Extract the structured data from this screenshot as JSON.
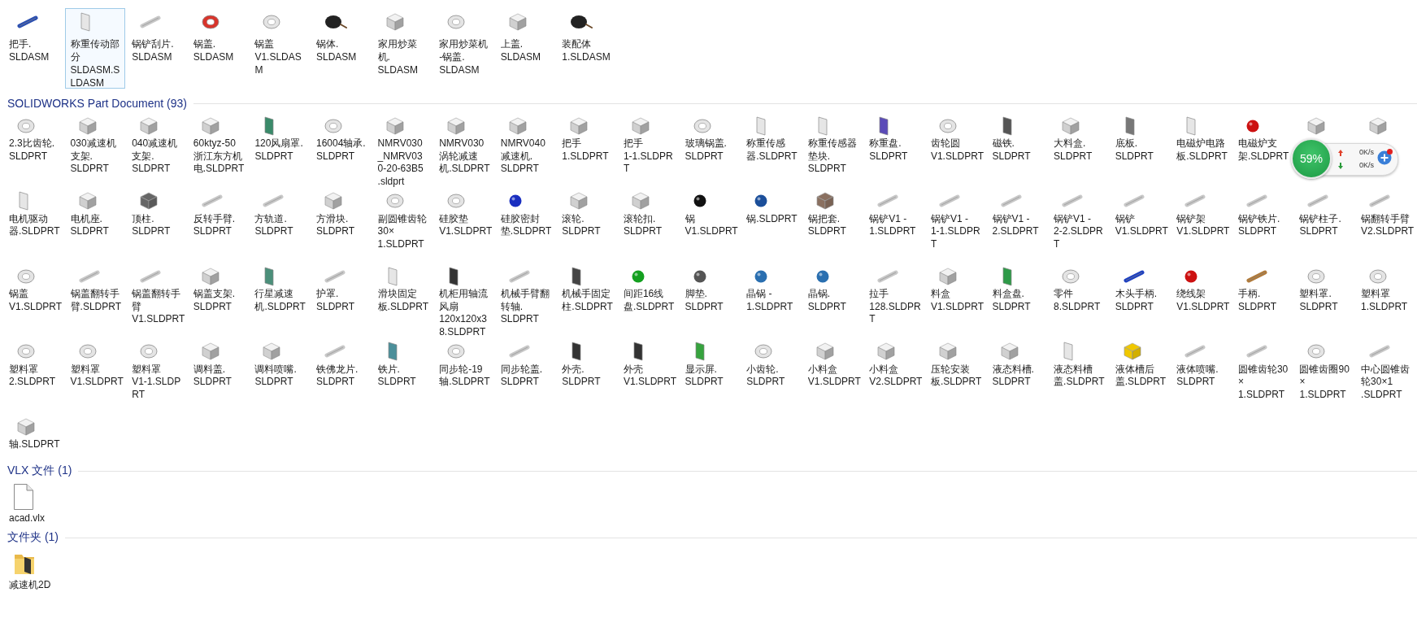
{
  "groups": [
    {
      "items": [
        {
          "label_lines": [
            "把手.",
            "SLDASM"
          ],
          "kind": "rod",
          "color": "#2b4fb0",
          "selected": false
        },
        {
          "label_lines": [
            "称重传动部",
            "分",
            "SLDASM.S",
            "LDASM"
          ],
          "kind": "panel",
          "selected": true
        },
        {
          "label_lines": [
            "锅铲刮片.",
            "SLDASM"
          ],
          "kind": "rod",
          "selected": false
        },
        {
          "label_lines": [
            "锅盖.",
            "SLDASM"
          ],
          "kind": "disc",
          "color": "#d9342b",
          "selected": false
        },
        {
          "label_lines": [
            "锅盖",
            "V1.SLDAS",
            "M"
          ],
          "kind": "disc",
          "selected": false
        },
        {
          "label_lines": [
            "锅体.",
            "SLDASM"
          ],
          "kind": "wok",
          "selected": false
        },
        {
          "label_lines": [
            "家用炒菜",
            "机.",
            "SLDASM"
          ],
          "kind": "block",
          "selected": false
        },
        {
          "label_lines": [
            "家用炒菜机",
            "-锅盖.",
            "SLDASM"
          ],
          "kind": "disc",
          "selected": false
        },
        {
          "label_lines": [
            "上盖.",
            "SLDASM"
          ],
          "kind": "block",
          "selected": false
        },
        {
          "label_lines": [
            "装配体",
            "1.SLDASM"
          ],
          "kind": "wok",
          "selected": false
        }
      ]
    },
    {
      "title": "SOLIDWORKS Part Document (93)",
      "items": [
        {
          "label_lines": [
            "2.3比齿轮.",
            "SLDPRT"
          ],
          "kind": "disc",
          "selected": false
        },
        {
          "label_lines": [
            "030减速机",
            "支架.",
            "SLDPRT"
          ],
          "kind": "block",
          "selected": false
        },
        {
          "label_lines": [
            "040减速机",
            "支架.",
            "SLDPRT"
          ],
          "kind": "block",
          "selected": false
        },
        {
          "label_lines": [
            "60ktyz-50",
            "浙江东方机",
            "电.SLDPRT"
          ],
          "kind": "block",
          "selected": false
        },
        {
          "label_lines": [
            "120风扇罩.",
            "SLDPRT"
          ],
          "kind": "panel",
          "color": "#3a8a6a",
          "selected": false
        },
        {
          "label_lines": [
            "16004轴承.",
            "SLDPRT"
          ],
          "kind": "disc",
          "selected": false
        },
        {
          "label_lines": [
            "NMRV030",
            "_NMRV03",
            "0-20-63B5",
            ".sldprt"
          ],
          "kind": "block",
          "selected": false
        },
        {
          "label_lines": [
            "NMRV030",
            "涡轮减速",
            "机.SLDPRT"
          ],
          "kind": "block",
          "selected": false
        },
        {
          "label_lines": [
            "NMRV040",
            "减速机.",
            "SLDPRT"
          ],
          "kind": "block",
          "selected": false
        },
        {
          "label_lines": [
            "把手",
            "1.SLDPRT"
          ],
          "kind": "block",
          "selected": false
        },
        {
          "label_lines": [
            "把手",
            "1-1.SLDPR",
            "T"
          ],
          "kind": "block",
          "selected": false
        },
        {
          "label_lines": [
            "玻璃锅盖.",
            "SLDPRT"
          ],
          "kind": "disc",
          "selected": false
        },
        {
          "label_lines": [
            "称重传感",
            "器.SLDPRT"
          ],
          "kind": "panel",
          "selected": false
        },
        {
          "label_lines": [
            "称重传感器",
            "垫块.",
            "SLDPRT"
          ],
          "kind": "panel",
          "selected": false
        },
        {
          "label_lines": [
            "称重盘.",
            "SLDPRT"
          ],
          "kind": "panel",
          "color": "#5b4bb8",
          "selected": false
        },
        {
          "label_lines": [
            "齿轮圆",
            "V1.SLDPRT"
          ],
          "kind": "disc",
          "selected": false
        },
        {
          "label_lines": [
            "磁铁.",
            "SLDPRT"
          ],
          "kind": "panel",
          "color": "#555555",
          "selected": false
        },
        {
          "label_lines": [
            "大料盒.",
            "SLDPRT"
          ],
          "kind": "block",
          "selected": false
        },
        {
          "label_lines": [
            "底板.",
            "SLDPRT"
          ],
          "kind": "panel",
          "color": "#777777",
          "selected": false
        },
        {
          "label_lines": [
            "电磁炉电路",
            "板.SLDPRT"
          ],
          "kind": "panel",
          "selected": false
        },
        {
          "label_lines": [
            "电磁炉支",
            "架.SLDPRT"
          ],
          "kind": "knob",
          "color": "#cc1111",
          "selected": false
        },
        {
          "kind": "block",
          "selected": false
        },
        {
          "kind": "block",
          "selected": false
        },
        {
          "label_lines": [
            "电机驱动",
            "器.SLDPRT"
          ],
          "kind": "panel",
          "selected": false
        },
        {
          "label_lines": [
            "电机座.",
            "SLDPRT"
          ],
          "kind": "block",
          "selected": false
        },
        {
          "label_lines": [
            "顶柱.",
            "SLDPRT"
          ],
          "kind": "block",
          "color": "#666666",
          "selected": false
        },
        {
          "label_lines": [
            "反转手臂.",
            "SLDPRT"
          ],
          "kind": "rod",
          "selected": false
        },
        {
          "label_lines": [
            "方轨道.",
            "SLDPRT"
          ],
          "kind": "rod",
          "selected": false
        },
        {
          "label_lines": [
            "方滑块.",
            "SLDPRT"
          ],
          "kind": "block",
          "selected": false
        },
        {
          "label_lines": [
            "副圆锥齿轮",
            "30×",
            "1.SLDPRT"
          ],
          "kind": "disc",
          "selected": false
        },
        {
          "label_lines": [
            "硅胶垫",
            "V1.SLDPRT"
          ],
          "kind": "disc",
          "selected": false
        },
        {
          "label_lines": [
            "硅胶密封",
            "垫.SLDPRT"
          ],
          "kind": "knob",
          "color": "#1a2fc0",
          "selected": false
        },
        {
          "label_lines": [
            "滚轮.",
            "SLDPRT"
          ],
          "kind": "block",
          "selected": false
        },
        {
          "label_lines": [
            "滚轮扣.",
            "SLDPRT"
          ],
          "kind": "block",
          "selected": false
        },
        {
          "label_lines": [
            "锅",
            "V1.SLDPRT"
          ],
          "kind": "knob",
          "color": "#111111",
          "selected": false
        },
        {
          "label_lines": [
            "锅.SLDPRT"
          ],
          "kind": "knob",
          "color": "#1c4f9a",
          "selected": false
        },
        {
          "label_lines": [
            "锅把套.",
            "SLDPRT"
          ],
          "kind": "block",
          "color": "#8a7060",
          "selected": false
        },
        {
          "label_lines": [
            "锅铲V1 -",
            "1.SLDPRT"
          ],
          "kind": "rod",
          "selected": false
        },
        {
          "label_lines": [
            "锅铲V1 -",
            "1-1.SLDPR",
            "T"
          ],
          "kind": "rod",
          "selected": false
        },
        {
          "label_lines": [
            "锅铲V1 -",
            "2.SLDPRT"
          ],
          "kind": "rod",
          "selected": false
        },
        {
          "label_lines": [
            "锅铲V1 -",
            "2-2.SLDPR",
            "T"
          ],
          "kind": "rod",
          "selected": false
        },
        {
          "label_lines": [
            "锅铲",
            "V1.SLDPRT"
          ],
          "kind": "rod",
          "selected": false
        },
        {
          "label_lines": [
            "锅铲架",
            "V1.SLDPRT"
          ],
          "kind": "rod",
          "selected": false
        },
        {
          "label_lines": [
            "锅铲铁片.",
            "SLDPRT"
          ],
          "kind": "rod",
          "selected": false
        },
        {
          "label_lines": [
            "锅铲柱子.",
            "SLDPRT"
          ],
          "kind": "rod",
          "selected": false
        },
        {
          "label_lines": [
            "锅翻转手臂",
            "V2.SLDPRT"
          ],
          "kind": "rod",
          "selected": false
        },
        {
          "label_lines": [
            "锅盖",
            "V1.SLDPRT"
          ],
          "kind": "disc",
          "selected": false
        },
        {
          "label_lines": [
            "锅盖翻转手",
            "臂.SLDPRT"
          ],
          "kind": "rod",
          "selected": false
        },
        {
          "label_lines": [
            "锅盖翻转手",
            "臂",
            "V1.SLDPRT"
          ],
          "kind": "rod",
          "selected": false
        },
        {
          "label_lines": [
            "锅盖支架.",
            "SLDPRT"
          ],
          "kind": "block",
          "selected": false
        },
        {
          "label_lines": [
            "行星减速",
            "机.SLDPRT"
          ],
          "kind": "panel",
          "color": "#4b8f7a",
          "selected": false
        },
        {
          "label_lines": [
            "护罩.",
            "SLDPRT"
          ],
          "kind": "rod",
          "selected": false
        },
        {
          "label_lines": [
            "滑块固定",
            "板.SLDPRT"
          ],
          "kind": "panel",
          "selected": false
        },
        {
          "label_lines": [
            "机柜用轴流",
            "风扇",
            "120x120x3",
            "8.SLDPRT"
          ],
          "kind": "panel",
          "color": "#333333",
          "selected": false
        },
        {
          "label_lines": [
            "机械手臂翻",
            "转轴.",
            "SLDPRT"
          ],
          "kind": "rod",
          "selected": false
        },
        {
          "label_lines": [
            "机械手固定",
            "柱.SLDPRT"
          ],
          "kind": "panel",
          "color": "#444444",
          "selected": false
        },
        {
          "label_lines": [
            "间距16线",
            "盘.SLDPRT"
          ],
          "kind": "knob",
          "color": "#14a020",
          "selected": false
        },
        {
          "label_lines": [
            "脚垫.",
            "SLDPRT"
          ],
          "kind": "knob",
          "color": "#555555",
          "selected": false
        },
        {
          "label_lines": [
            "晶锅 -",
            "1.SLDPRT"
          ],
          "kind": "knob",
          "color": "#2a6fb0",
          "selected": false
        },
        {
          "label_lines": [
            "晶锅.",
            "SLDPRT"
          ],
          "kind": "knob",
          "color": "#2a6fb0",
          "selected": false
        },
        {
          "label_lines": [
            "拉手",
            "128.SLDPR",
            "T"
          ],
          "kind": "rod",
          "selected": false
        },
        {
          "label_lines": [
            "料盒",
            "V1.SLDPRT"
          ],
          "kind": "block",
          "selected": false
        },
        {
          "label_lines": [
            "料盒盘.",
            "SLDPRT"
          ],
          "kind": "panel",
          "color": "#2e9a48",
          "selected": false
        },
        {
          "label_lines": [
            "零件",
            "8.SLDPRT"
          ],
          "kind": "disc",
          "selected": false
        },
        {
          "label_lines": [
            "木头手柄.",
            "SLDPRT"
          ],
          "kind": "rod",
          "color": "#1e40c0",
          "selected": false
        },
        {
          "label_lines": [
            "绕线架",
            "V1.SLDPRT"
          ],
          "kind": "knob",
          "color": "#cc1111",
          "selected": false
        },
        {
          "label_lines": [
            "手柄.",
            "SLDPRT"
          ],
          "kind": "rod",
          "color": "#b07a3a",
          "selected": false
        },
        {
          "label_lines": [
            "塑料罩.",
            "SLDPRT"
          ],
          "kind": "disc",
          "selected": false
        },
        {
          "label_lines": [
            "塑料罩",
            "1.SLDPRT"
          ],
          "kind": "disc",
          "selected": false
        },
        {
          "label_lines": [
            "塑料罩",
            "2.SLDPRT"
          ],
          "kind": "disc",
          "selected": false
        },
        {
          "label_lines": [
            "塑料罩",
            "V1.SLDPRT"
          ],
          "kind": "disc",
          "selected": false
        },
        {
          "label_lines": [
            "塑料罩",
            "V1-1.SLDP",
            "RT"
          ],
          "kind": "disc",
          "selected": false
        },
        {
          "label_lines": [
            "调料盖.",
            "SLDPRT"
          ],
          "kind": "block",
          "selected": false
        },
        {
          "label_lines": [
            "调料喷嘴.",
            "SLDPRT"
          ],
          "kind": "block",
          "selected": false
        },
        {
          "label_lines": [
            "铁佛龙片.",
            "SLDPRT"
          ],
          "kind": "rod",
          "selected": false
        },
        {
          "label_lines": [
            "铁片.",
            "SLDPRT"
          ],
          "kind": "panel",
          "color": "#4b8f9a",
          "selected": false
        },
        {
          "label_lines": [
            "同步轮-19",
            "轴.SLDPRT"
          ],
          "kind": "disc",
          "selected": false
        },
        {
          "label_lines": [
            "同步轮盖.",
            "SLDPRT"
          ],
          "kind": "rod",
          "selected": false
        },
        {
          "label_lines": [
            "外壳.",
            "SLDPRT"
          ],
          "kind": "panel",
          "color": "#333333",
          "selected": false
        },
        {
          "label_lines": [
            "外壳",
            "V1.SLDPRT"
          ],
          "kind": "panel",
          "color": "#333333",
          "selected": false
        },
        {
          "label_lines": [
            "显示屏.",
            "SLDPRT"
          ],
          "kind": "panel",
          "color": "#36a33e",
          "selected": false
        },
        {
          "label_lines": [
            "小齿轮.",
            "SLDPRT"
          ],
          "kind": "disc",
          "selected": false
        },
        {
          "label_lines": [
            "小料盒",
            "V1.SLDPRT"
          ],
          "kind": "block",
          "selected": false
        },
        {
          "label_lines": [
            "小料盒",
            "V2.SLDPRT"
          ],
          "kind": "block",
          "selected": false
        },
        {
          "label_lines": [
            "压轮安装",
            "板.SLDPRT"
          ],
          "kind": "block",
          "selected": false
        },
        {
          "label_lines": [
            "液态料槽.",
            "SLDPRT"
          ],
          "kind": "block",
          "selected": false
        },
        {
          "label_lines": [
            "液态料槽",
            "盖.SLDPRT"
          ],
          "kind": "panel",
          "selected": false
        },
        {
          "label_lines": [
            "液体槽后",
            "盖.SLDPRT"
          ],
          "kind": "block",
          "color": "#f0c800",
          "selected": false
        },
        {
          "label_lines": [
            "液体喷嘴.",
            "SLDPRT"
          ],
          "kind": "rod",
          "selected": false
        },
        {
          "label_lines": [
            "圆锥齿轮30",
            "×",
            "1.SLDPRT"
          ],
          "kind": "rod",
          "selected": false
        },
        {
          "label_lines": [
            "圆锥齿圈90",
            "×",
            "1.SLDPRT"
          ],
          "kind": "disc",
          "selected": false
        },
        {
          "label_lines": [
            "中心圆锥齿",
            "轮30×1",
            ".SLDPRT"
          ],
          "kind": "rod",
          "selected": false
        },
        {
          "label_lines": [
            "轴.SLDPRT"
          ],
          "kind": "block",
          "selected": false
        }
      ]
    },
    {
      "title": "VLX 文件 (1)",
      "items": [
        {
          "label_lines": [
            "acad.vlx"
          ],
          "kind": "document",
          "selected": false
        }
      ]
    },
    {
      "title": "文件夹 (1)",
      "items": [
        {
          "label_lines": [
            "减速机2D"
          ],
          "kind": "folder",
          "selected": false
        }
      ]
    }
  ],
  "speed_widget": {
    "percent": "59%",
    "upload": "0K/s",
    "download": "0K/s"
  }
}
